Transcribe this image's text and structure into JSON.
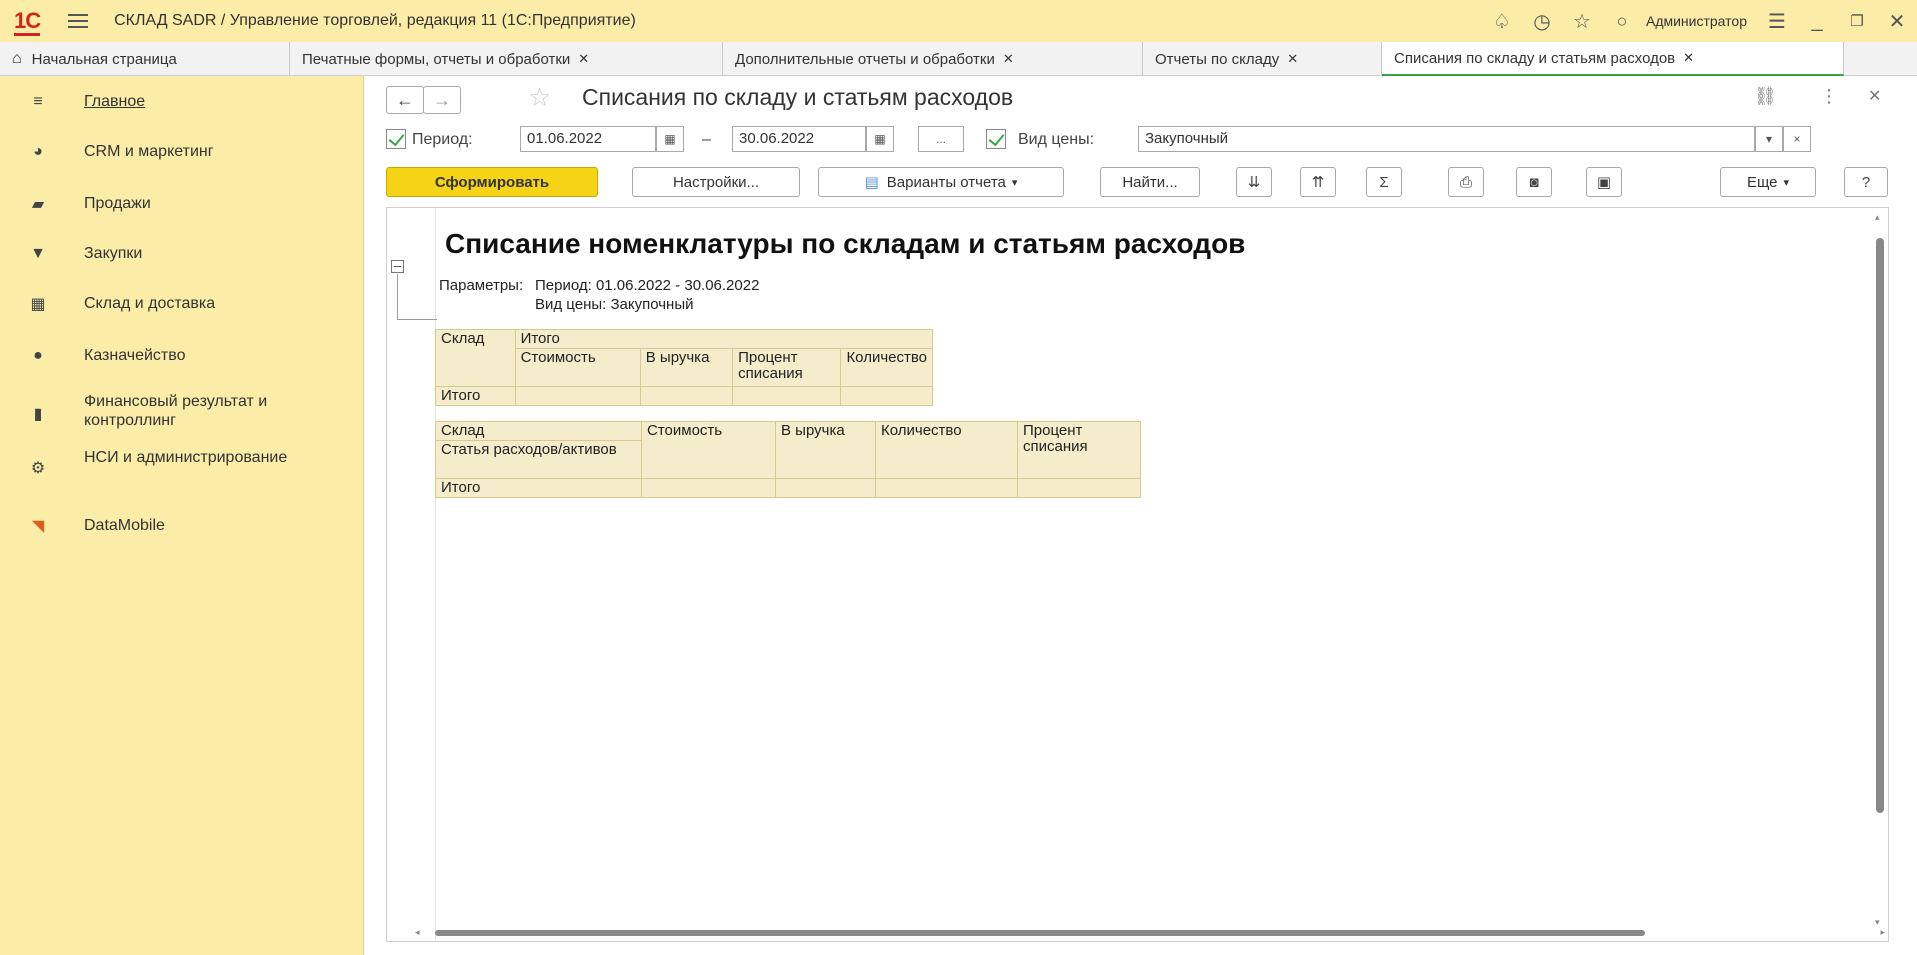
{
  "titlebar": {
    "app_title": "СКЛАД SADR / Управление торговлей, редакция 11  (1С:Предприятие)",
    "user": "Администратор"
  },
  "tabs": [
    {
      "label": "Начальная страница",
      "closable": false
    },
    {
      "label": "Печатные формы, отчеты и обработки",
      "closable": true
    },
    {
      "label": "Дополнительные отчеты и обработки",
      "closable": true
    },
    {
      "label": "Отчеты по складу",
      "closable": true
    },
    {
      "label": "Списания по складу и статьям расходов",
      "closable": true
    }
  ],
  "sidebar": {
    "items": [
      {
        "label": "Главное"
      },
      {
        "label": "CRM и маркетинг"
      },
      {
        "label": "Продажи"
      },
      {
        "label": "Закупки"
      },
      {
        "label": "Склад и доставка"
      },
      {
        "label": "Казначейство"
      },
      {
        "label": "Финансовый результат и контроллинг"
      },
      {
        "label": "НСИ и администрирование"
      },
      {
        "label": "DataMobile"
      }
    ]
  },
  "form": {
    "title": "Списания по складу и статьям расходов",
    "period_label": "Период:",
    "date_from": "01.06.2022",
    "date_to": "30.06.2022",
    "dash": "–",
    "ellipsis": "...",
    "price_type_label": "Вид цены:",
    "price_type_value": "Закупочный"
  },
  "toolbar": {
    "generate": "Сформировать",
    "settings": "Настройки...",
    "variants": "Варианты отчета",
    "find": "Найти...",
    "sum": "Σ",
    "more": "Еще",
    "help": "?"
  },
  "report": {
    "title": "Списание номенклатуры по складам и статьям расходов",
    "params_label": "Параметры:",
    "param_period": "Период: 01.06.2022 - 30.06.2022",
    "param_price": "Вид цены: Закупочный",
    "table1": {
      "col_sklad": "Склад",
      "col_itogo": "Итого",
      "col_cost": "Стоимость",
      "col_revenue": "В ыручка",
      "col_percent": "Процент списания",
      "col_qty": "Количество",
      "row_total": "Итого"
    },
    "table2": {
      "col_sklad": "Склад",
      "col_article": "Статья расходов/активов",
      "col_cost": "Стоимость",
      "col_revenue": "В ыручка",
      "col_qty": "Количество",
      "col_percent": "Процент списания",
      "row_total": "Итого"
    }
  }
}
